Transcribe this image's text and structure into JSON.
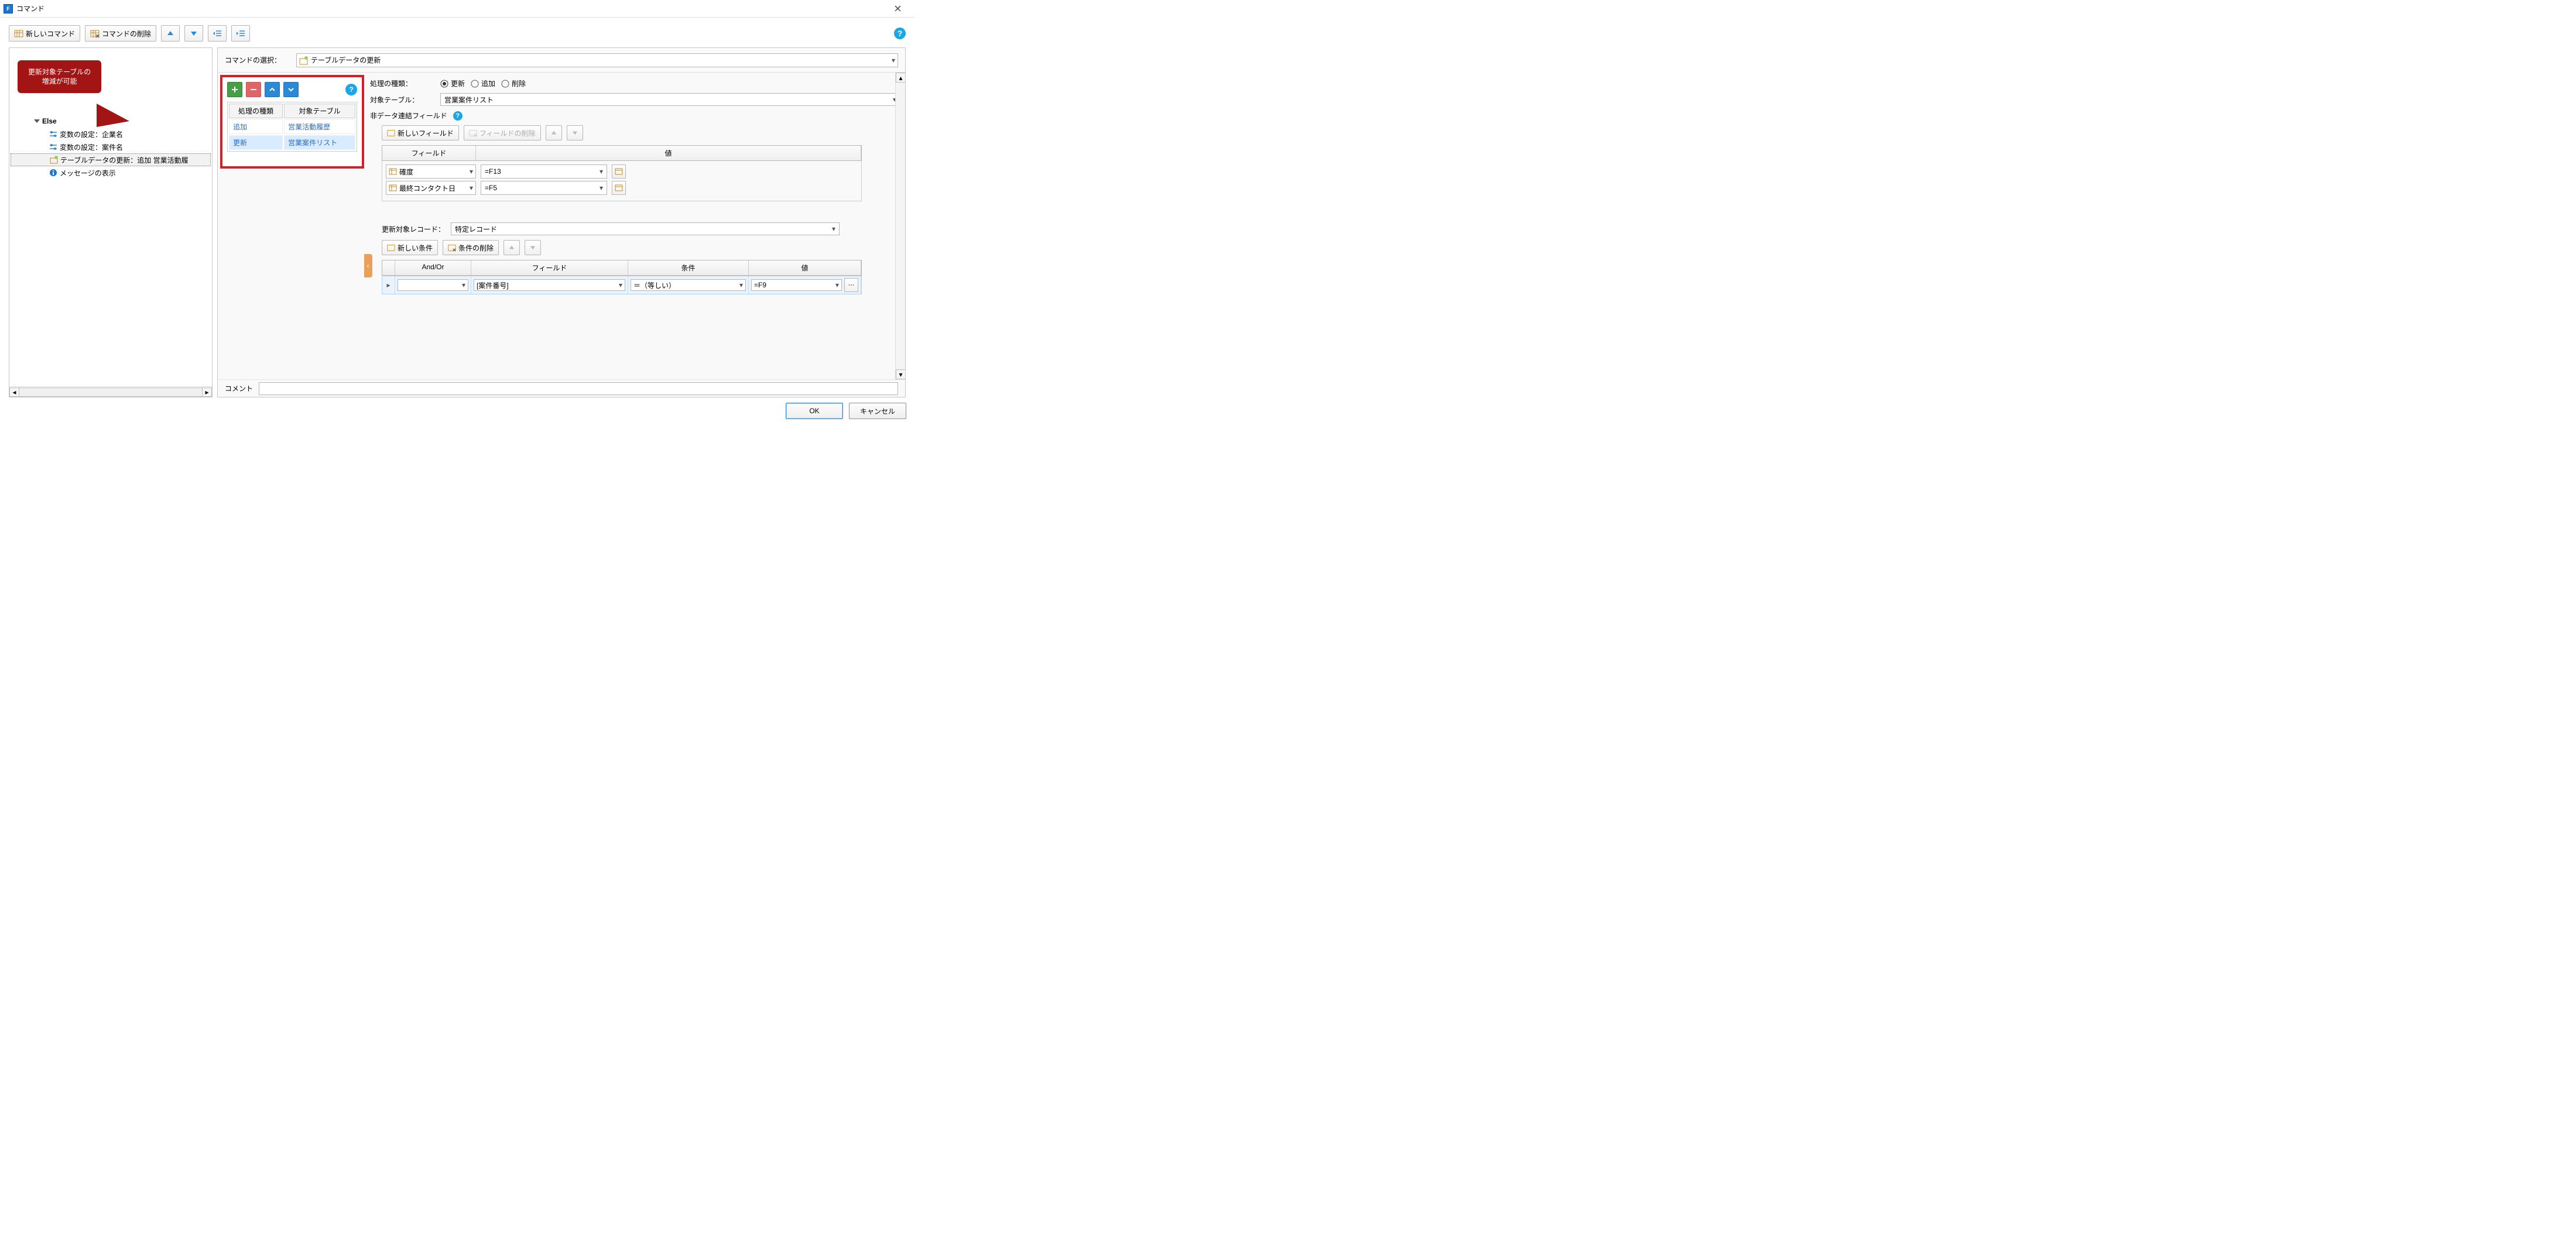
{
  "title": "コマンド",
  "toolbar": {
    "new_cmd": "新しいコマンド",
    "del_cmd": "コマンドの削除"
  },
  "callout": {
    "line1": "更新対象テーブルの",
    "line2": "増減が可能"
  },
  "tree": {
    "else": "Else",
    "items": [
      "変数の設定：企業名",
      "変数の設定：案件名",
      "テーブルデータの更新：追加 営業活動履",
      "メッセージの表示"
    ]
  },
  "cmd_select": {
    "label": "コマンドの選択：",
    "value": "テーブルデータの更新"
  },
  "mini": {
    "h1": "処理の種類",
    "h2": "対象テーブル",
    "rows": [
      {
        "type": "追加",
        "table": "営業活動履歴"
      },
      {
        "type": "更新",
        "table": "営業案件リスト"
      }
    ]
  },
  "proc": {
    "label": "処理の種類：",
    "opts": [
      "更新",
      "追加",
      "削除"
    ],
    "selected": "更新"
  },
  "target": {
    "label": "対象テーブル：",
    "value": "営業案件リスト"
  },
  "nondata_label": "非データ連結フィールド",
  "field_tb": {
    "new": "新しいフィールド",
    "del": "フィールドの削除"
  },
  "field_hdr": {
    "field": "フィールド",
    "value": "値"
  },
  "fields": [
    {
      "name": "確度",
      "value": "=F13"
    },
    {
      "name": "最終コンタクト日",
      "value": "=F5"
    }
  ],
  "upd_records": {
    "label": "更新対象レコード：",
    "value": "特定レコード"
  },
  "cond_tb": {
    "new": "新しい条件",
    "del": "条件の削除"
  },
  "cond_hdr": {
    "andor": "And/Or",
    "field": "フィールド",
    "cond": "条件",
    "value": "値"
  },
  "cond_row": {
    "andor": "",
    "field": "[案件番号]",
    "cond": "＝（等しい）",
    "value": "=F9"
  },
  "comment_label": "コメント",
  "footer": {
    "ok": "OK",
    "cancel": "キャンセル"
  }
}
